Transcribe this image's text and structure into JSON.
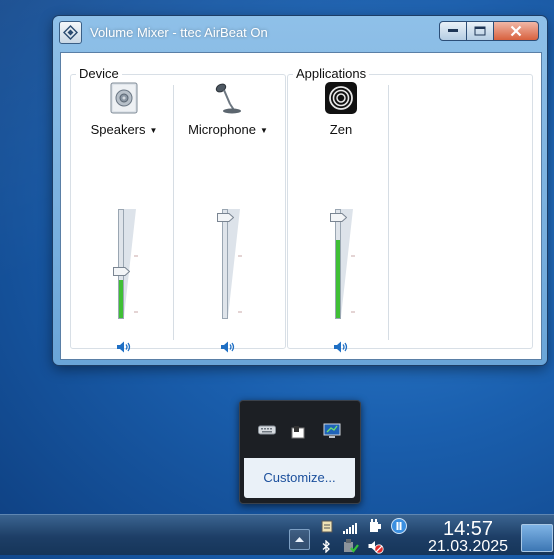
{
  "window": {
    "title": "Volume Mixer - ttec AirBeat On"
  },
  "device_group": {
    "label": "Device",
    "channels": [
      {
        "name": "Speakers",
        "has_menu": true,
        "icon": "speaker-icon",
        "level": 0.45,
        "meter": 0.35
      },
      {
        "name": "Microphone",
        "has_menu": true,
        "icon": "microphone-icon",
        "level": 1.0,
        "meter": 0.0
      }
    ]
  },
  "applications_group": {
    "label": "Applications",
    "channels": [
      {
        "name": "Zen",
        "icon": "zen-app-icon",
        "level": 1.0,
        "meter": 0.72
      }
    ]
  },
  "tray_flyout": {
    "icons": [
      "keyboard-icon",
      "safely-remove-icon",
      "display-icon"
    ],
    "customize_label": "Customize..."
  },
  "taskbar": {
    "time": "14:57",
    "date": "21.03.2025",
    "tray_icons": [
      "clipboard-icon",
      "network-signal-icon",
      "power-plug-icon",
      "app-tray-icon",
      "bluetooth-icon",
      "safe-remove-check-icon",
      "volume-muted-icon"
    ]
  },
  "colors": {
    "meter_green": "#3fbf35",
    "taskbar": "#1d3e66",
    "accent_link": "#1b4f9c"
  }
}
